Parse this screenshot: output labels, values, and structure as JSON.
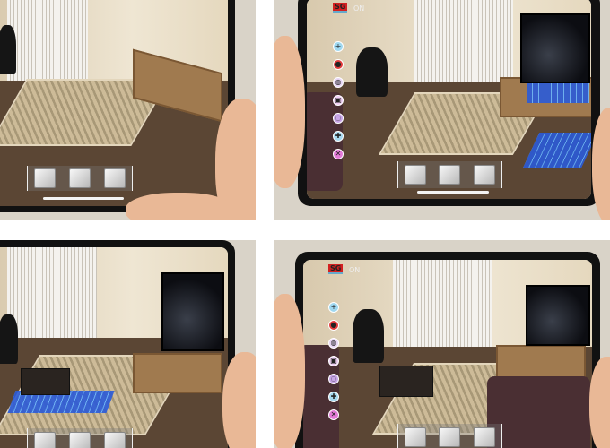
{
  "panels": [
    {
      "id": "top-left",
      "toolbar": [
        "cube-icon",
        "chair-object-icon",
        "lamp-object-icon"
      ]
    },
    {
      "id": "top-right",
      "sg_label": "SG",
      "on_label": "ON",
      "menu": [
        "plus-icon",
        "color-palette-icon",
        "sphere-icon",
        "cube-icon",
        "texture-icon",
        "move-icon",
        "delete-icon"
      ],
      "menu_glyphs": [
        "+",
        "●",
        "◍",
        "▣",
        "◌",
        "✚",
        "✕"
      ],
      "menu_colors": [
        "#9fd8f0",
        "#e23b3b",
        "#e8d6f5",
        "#f0d0f5",
        "#c9a6e8",
        "#a6d8ef",
        "#e47ad8"
      ],
      "toolbar": [
        "table-object-icon",
        "panel-object-icon",
        "box-object-icon"
      ]
    },
    {
      "id": "bottom-left",
      "toolbar": [
        "table-object-icon",
        "bench-object-icon",
        "panel-object-icon"
      ]
    },
    {
      "id": "bottom-right",
      "sg_label": "SG",
      "on_label": "ON",
      "menu": [
        "plus-icon",
        "color-palette-icon",
        "sphere-icon",
        "cube-icon",
        "texture-icon",
        "move-icon",
        "delete-icon"
      ],
      "menu_glyphs": [
        "+",
        "●",
        "◍",
        "▣",
        "◌",
        "✚",
        "✕"
      ],
      "menu_colors": [
        "#9fd8f0",
        "#e23b3b",
        "#e8d6f5",
        "#f0d0f5",
        "#c9a6e8",
        "#a6d8ef",
        "#e47ad8"
      ],
      "toolbar": [
        "panel-object-icon",
        "chair-object-icon",
        "lamp-object-icon"
      ]
    }
  ]
}
